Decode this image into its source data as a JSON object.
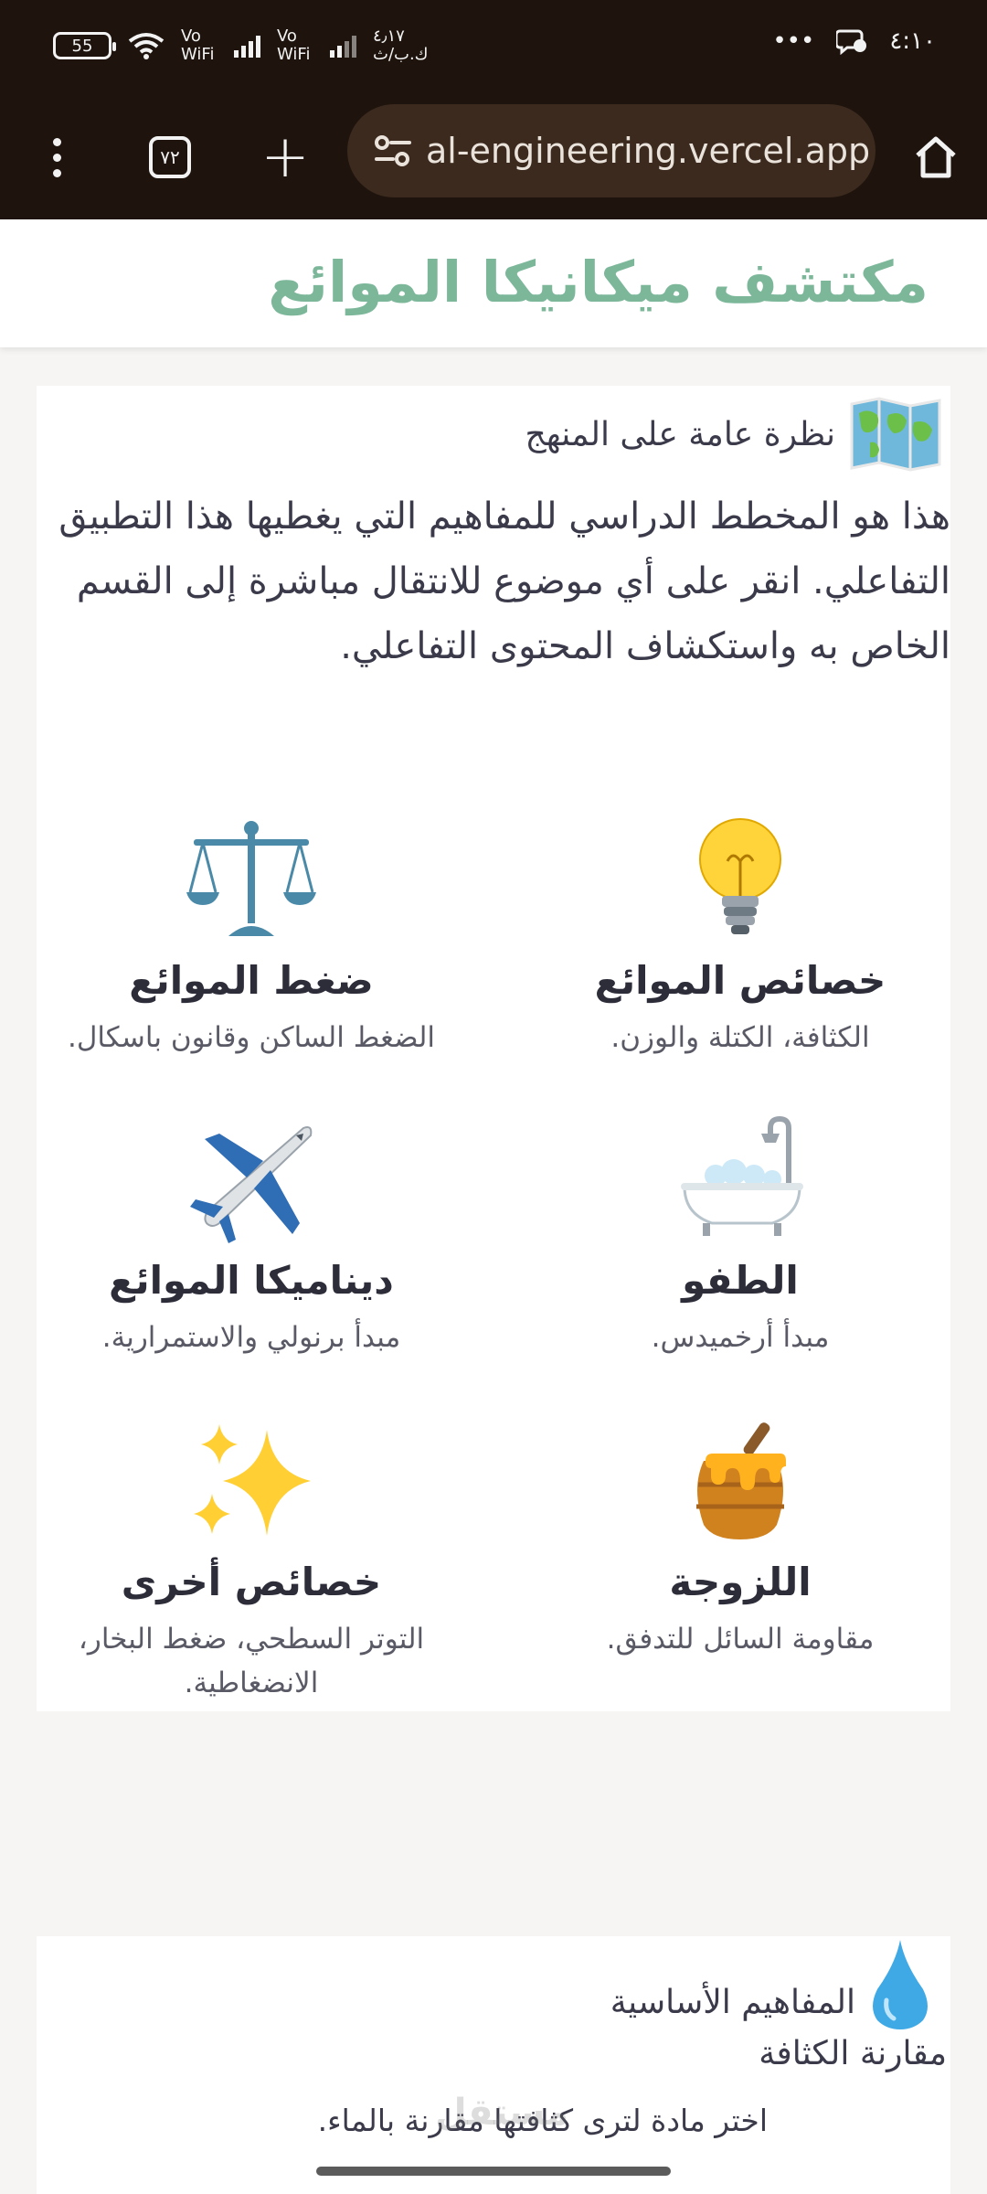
{
  "status_bar": {
    "battery": "55",
    "wifi_label_1": "Vo WiFi",
    "wifi_label_2": "Vo WiFi",
    "speed": "٤٫١٧ ك.ب/ث",
    "time": "٤:١٠",
    "more": "•••"
  },
  "browser": {
    "tab_count": "٧٢",
    "url": "al-engineering.vercel.app"
  },
  "app": {
    "title": "مكتشف ميكانيكا الموائع"
  },
  "overview": {
    "title": "نظرة عامة على المنهج",
    "intro": "هذا هو المخطط الدراسي للمفاهيم التي يغطيها هذا التطبيق التفاعلي. انقر على أي موضوع للانتقال مباشرة إلى القسم الخاص به واستكشاف المحتوى التفاعلي.",
    "topics": [
      {
        "title": "خصائص الموائع",
        "desc": "الكثافة، الكتلة والوزن.",
        "icon": "light-bulb-icon"
      },
      {
        "title": "ضغط الموائع",
        "desc": "الضغط الساكن وقانون باسكال.",
        "icon": "balance-scale-icon"
      },
      {
        "title": "الطفو",
        "desc": "مبدأ أرخميدس.",
        "icon": "bathtub-icon"
      },
      {
        "title": "ديناميكا الموائع",
        "desc": "مبدأ برنولي والاستمرارية.",
        "icon": "airplane-icon"
      },
      {
        "title": "اللزوجة",
        "desc": "مقاومة السائل للتدفق.",
        "icon": "honey-pot-icon"
      },
      {
        "title": "خصائص أخرى",
        "desc": "التوتر السطحي، ضغط البخار، الانضغاطية.",
        "icon": "sparkles-icon"
      }
    ]
  },
  "concepts": {
    "title": "المفاهيم الأساسية",
    "subtitle": "مقارنة الكثافة",
    "desc": "اختر مادة لترى كثافتها مقارنة بالماء."
  },
  "watermark": "مستقل",
  "colors": {
    "accent": "#7cb79a",
    "toolbar": "#1e140d",
    "url_bar": "#3b2a1d"
  }
}
